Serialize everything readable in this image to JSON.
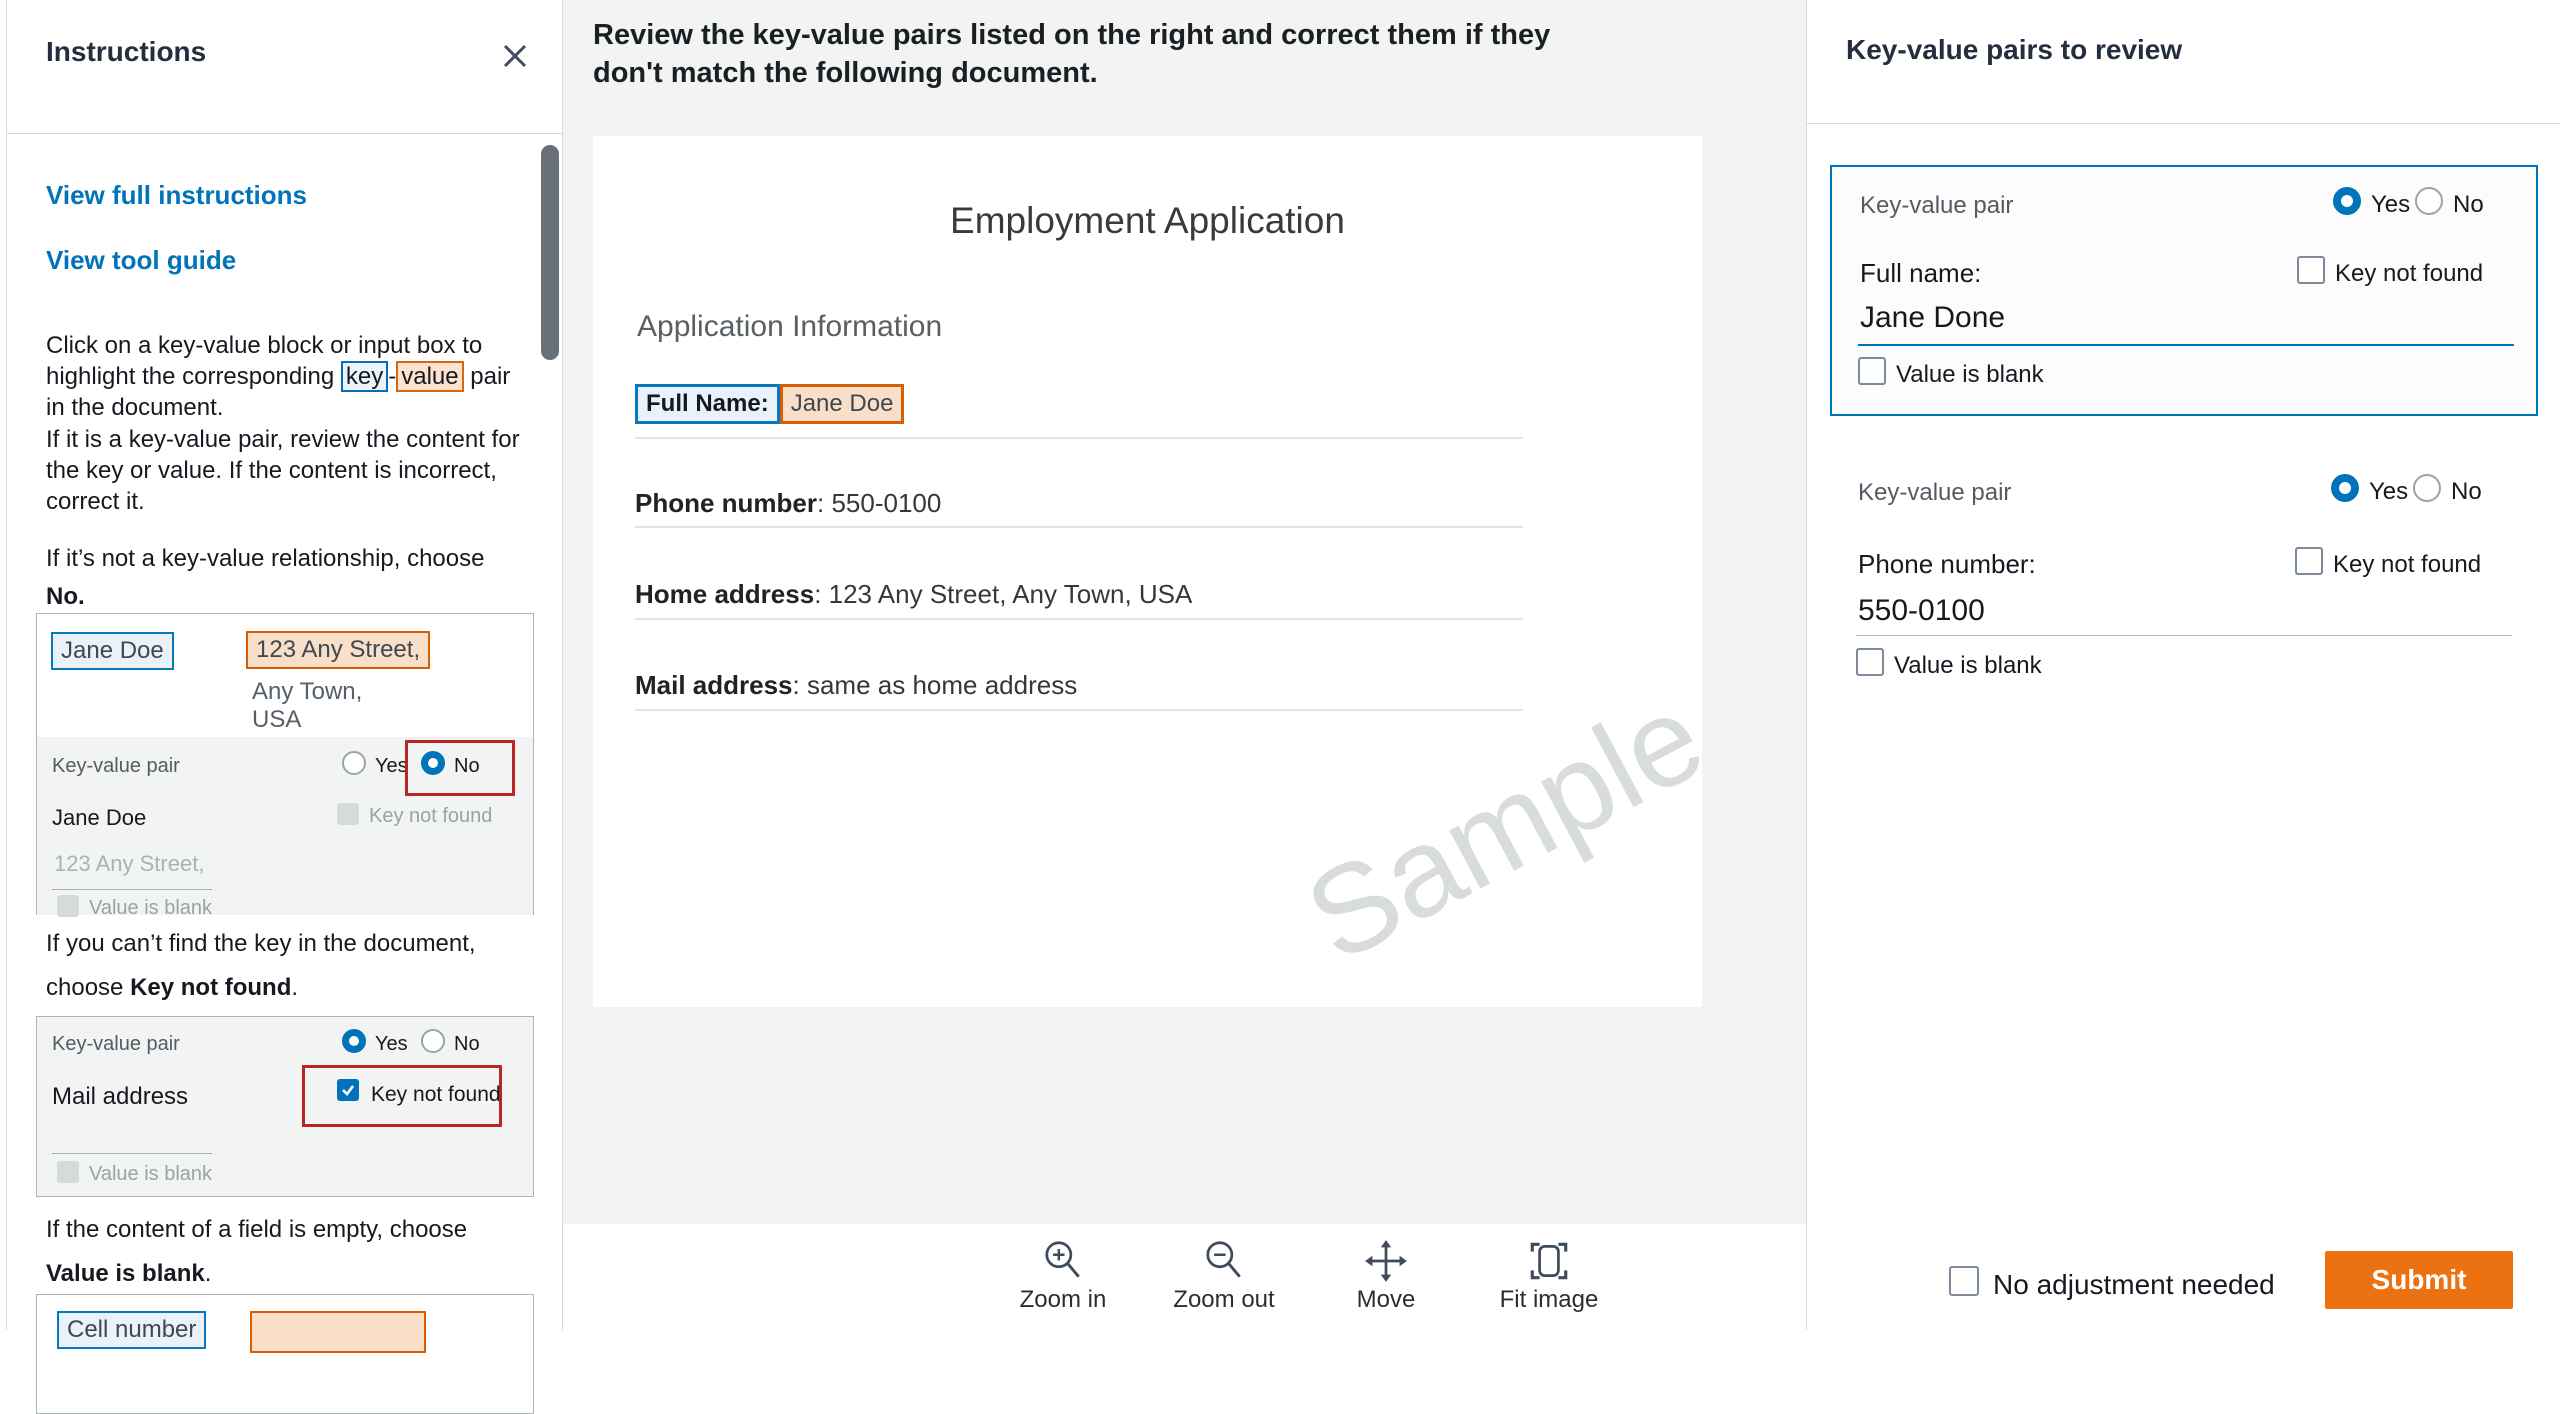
{
  "colors": {
    "accent_blue": "#0073bb",
    "submit_orange": "#ec7211",
    "error_red": "#ba2525",
    "key_highlight_border": "#0878bd",
    "key_highlight_fill": "#e9f2fb",
    "value_highlight_border": "#d45f07",
    "value_highlight_fill": "#f9dfc8"
  },
  "instructions": {
    "title": "Instructions",
    "link_full": "View full instructions",
    "link_tool": "View tool guide",
    "p1_before": "Click on a key-value block or input box to highlight the corresponding ",
    "p1_key": "key",
    "p1_dash": "-",
    "p1_value": "value",
    "p1_after": " pair in the document.",
    "p2": "If it is a key-value pair, review the content for the key or value. If the content is incorrect, correct it.",
    "p3_before": "If it’s not a key-value relationship, choose ",
    "p3_bold": "No.",
    "p4_line1": "If you can’t find the key in the document,",
    "p4_before": "choose ",
    "p4_bold": "Key not found",
    "p4_after": ".",
    "p5_line1": "If the content of a field is empty, choose",
    "p5_bold": "Value is blank",
    "p5_after": ".",
    "example1": {
      "key_chip": "Jane Doe",
      "value_chip": "123 Any Street,",
      "value_line2": "Any Town,",
      "value_line3": "USA",
      "kv_label": "Key-value pair",
      "yes": "Yes",
      "no": "No",
      "key_text": "Jane Doe",
      "key_not_found": "Key not found",
      "value_text": "123 Any Street,",
      "value_blank": "Value is blank"
    },
    "example2": {
      "kv_label": "Key-value pair",
      "yes": "Yes",
      "no": "No",
      "key_text": "Mail address",
      "key_not_found": "Key not found",
      "value_blank": "Value is blank"
    },
    "example3": {
      "key_chip": "Cell number"
    }
  },
  "main": {
    "header_line1": "Review the key-value pairs listed on the right and correct them if they",
    "header_line2": "don't match the following document.",
    "document": {
      "title": "Employment Application",
      "section": "Application Information",
      "full_name_key": "Full Name:",
      "full_name_value": "Jane Doe",
      "rows": [
        {
          "key": "Phone number",
          "value": ": 550-0100"
        },
        {
          "key": "Home address",
          "value": ": 123 Any Street, Any Town, USA"
        },
        {
          "key": "Mail address",
          "value": ": same as home address"
        }
      ],
      "watermark": "Sample"
    },
    "toolbar": [
      {
        "label": "Zoom in"
      },
      {
        "label": "Zoom out"
      },
      {
        "label": "Move"
      },
      {
        "label": "Fit image"
      }
    ]
  },
  "review": {
    "title": "Key-value pairs to review",
    "cards": [
      {
        "kv_label": "Key-value pair",
        "yes": "Yes",
        "no": "No",
        "key_label": "Full name:",
        "key_not_found": "Key not found",
        "value": "Jane Done",
        "value_blank": "Value is blank"
      },
      {
        "kv_label": "Key-value pair",
        "yes": "Yes",
        "no": "No",
        "key_label": "Phone number:",
        "key_not_found": "Key not found",
        "value": "550-0100",
        "value_blank": "Value is blank"
      }
    ],
    "footer": {
      "no_adjustment": "No adjustment needed",
      "submit": "Submit"
    }
  }
}
